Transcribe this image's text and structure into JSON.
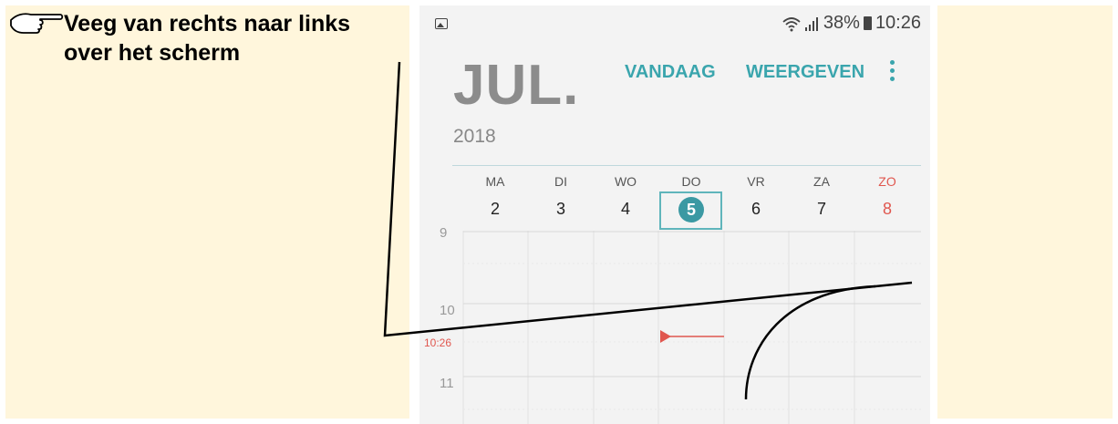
{
  "instruction": {
    "text": "Veeg van rechts naar links over het scherm",
    "hand_icon": "pointing-hand-icon"
  },
  "status_bar": {
    "battery": "38%",
    "time": "10:26",
    "icons": [
      "gallery-icon",
      "wifi-icon",
      "signal-icon",
      "battery-icon"
    ]
  },
  "header": {
    "month": "JUL.",
    "year": "2018",
    "today_button": "VANDAAG",
    "view_button": "WEERGEVEN",
    "more_icon": "more-vertical-icon"
  },
  "week": {
    "days": [
      {
        "name": "MA",
        "date": "2"
      },
      {
        "name": "DI",
        "date": "3"
      },
      {
        "name": "WO",
        "date": "4"
      },
      {
        "name": "DO",
        "date": "5"
      },
      {
        "name": "VR",
        "date": "6"
      },
      {
        "name": "ZA",
        "date": "7"
      },
      {
        "name": "ZO",
        "date": "8"
      }
    ],
    "today_date": "5"
  },
  "timeline": {
    "hours": [
      "9",
      "10",
      "11"
    ],
    "current_time": "10:26"
  },
  "colors": {
    "accent": "#3aa5ad",
    "sunday": "#e0574f",
    "now_line": "#e0574f",
    "panel_bg": "#fff6dc"
  }
}
